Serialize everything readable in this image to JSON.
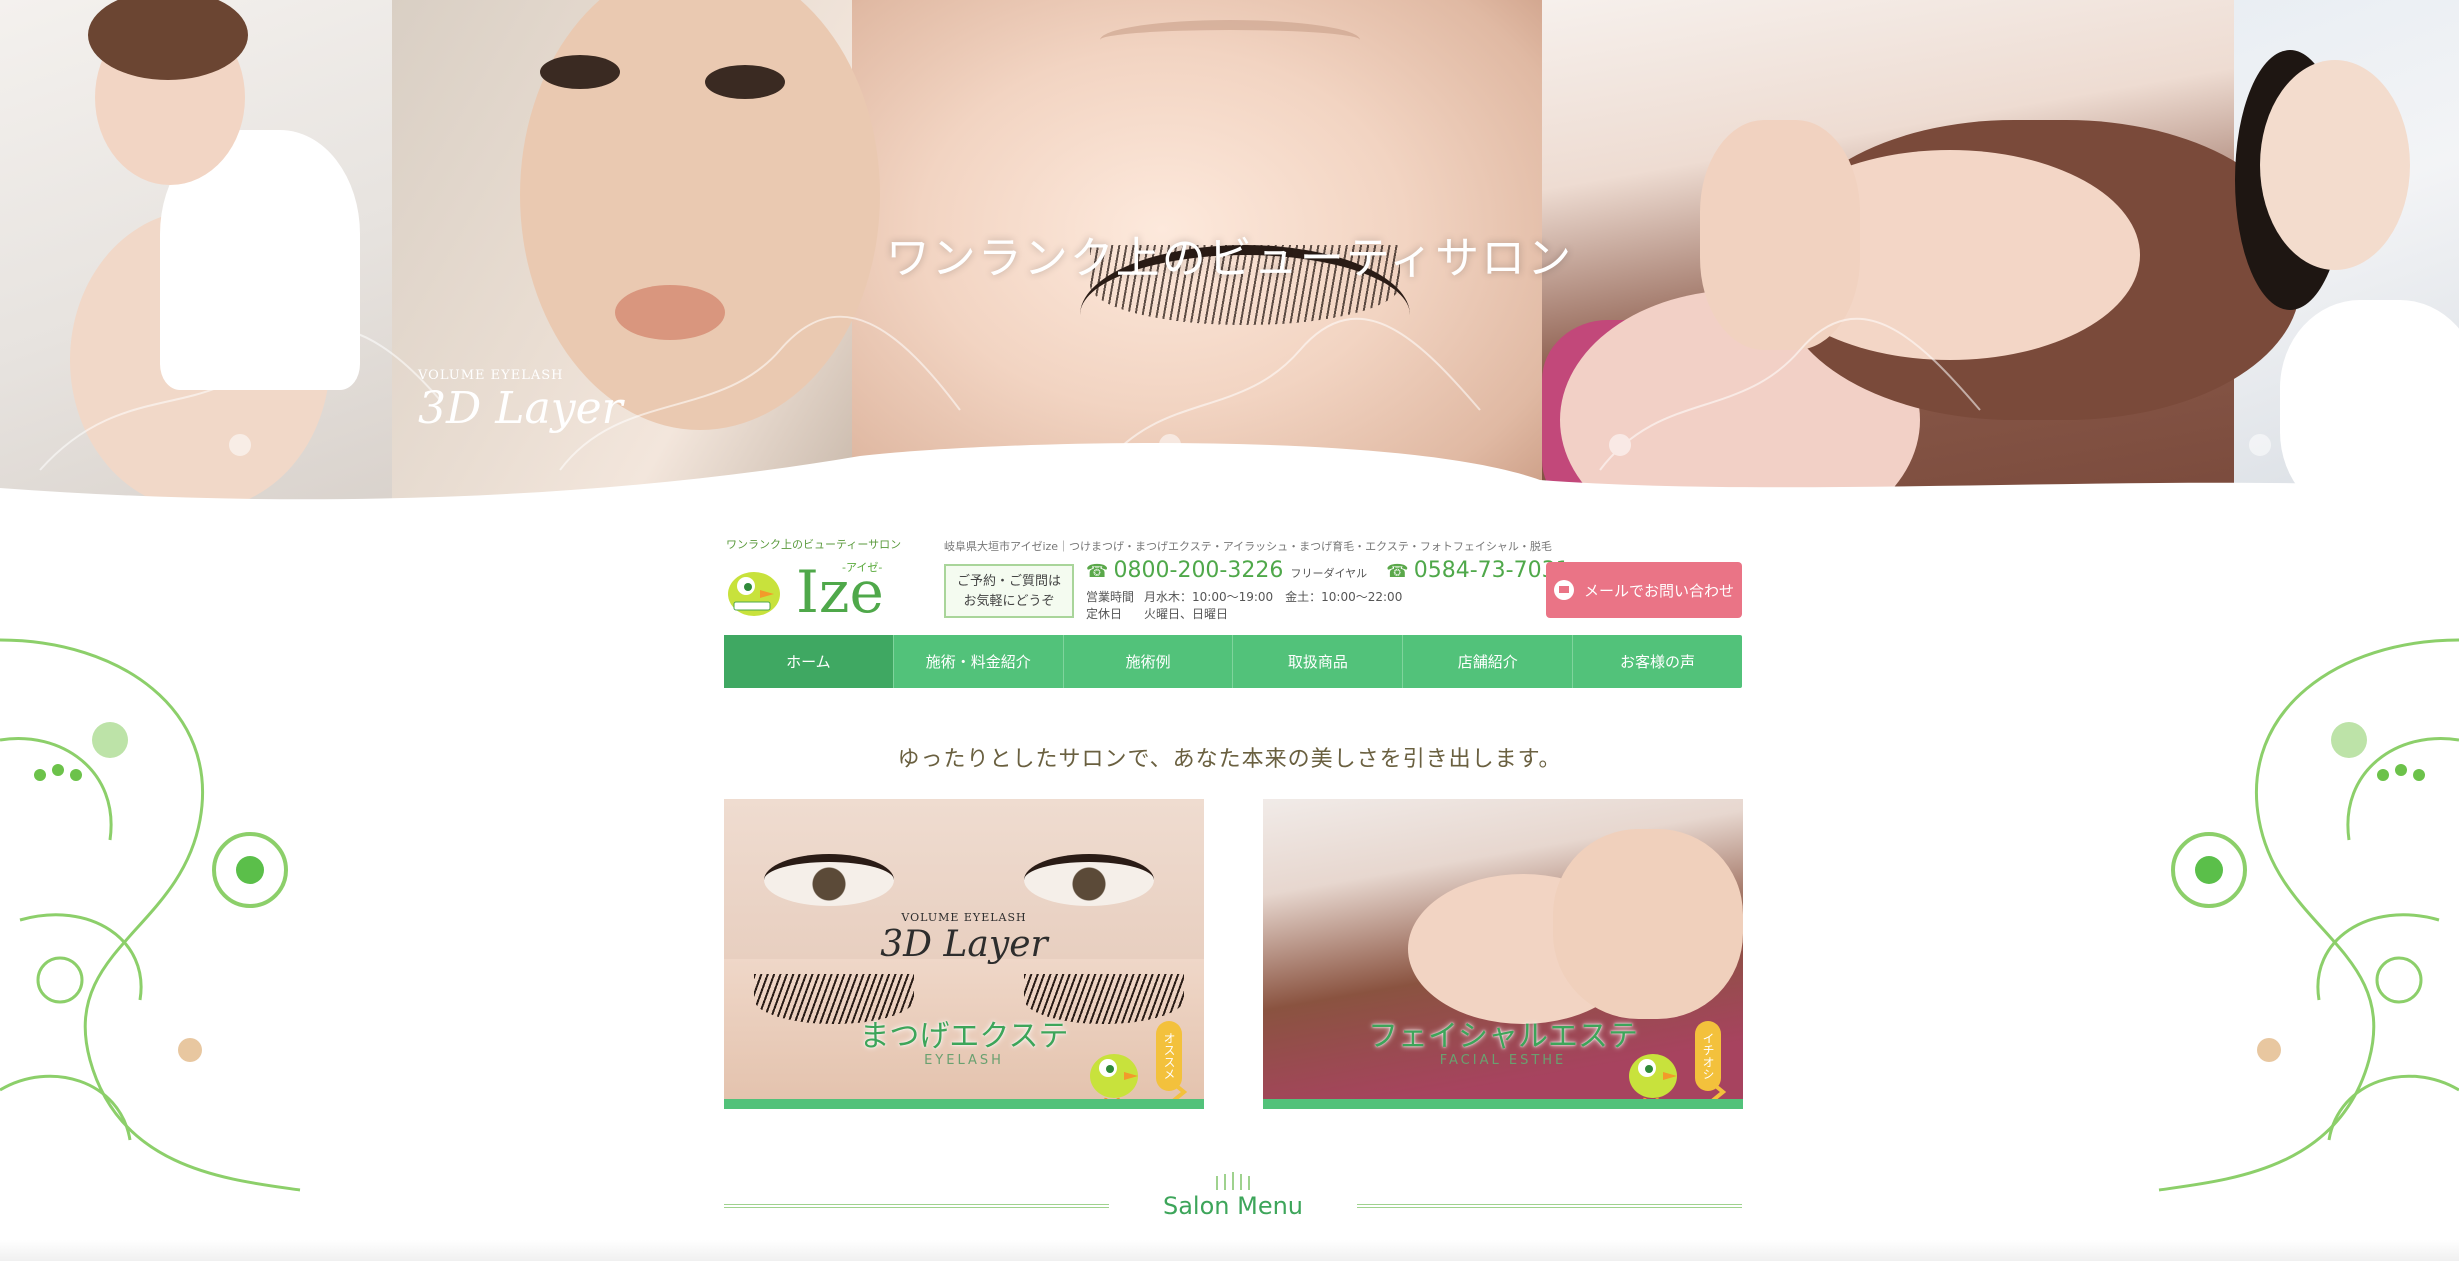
{
  "hero": {
    "title": "ワンランク上のビューティサロン",
    "panel2_brand_small": "VOLUME EYELASH",
    "panel2_brand_big": "3D Layer"
  },
  "header": {
    "logo_tagline": "ワンランク上のビューティーサロン",
    "logo_kana": "-アイゼ-",
    "logo_word": "Ize",
    "description": "岐阜県大垣市アイゼize｜つけまつげ・まつげエクステ・アイラッシュ・まつげ育毛・エクステ・フォトフェイシャル・脱毛",
    "inquiry_line1": "ご予約・ご質問は",
    "inquiry_line2": "お気軽にどうぞ",
    "phone1": "0800-200-3226",
    "phone1_note": "フリーダイヤル",
    "phone2": "0584-73-7031",
    "hours_label": "営業時間",
    "hours_value": "月水木：10:00〜19:00　金土：10:00〜22:00",
    "closed_label": "定休日",
    "closed_value": "火曜日、日曜日",
    "mail_button": "メールでお問い合わせ"
  },
  "nav": {
    "items": [
      {
        "label": "ホーム"
      },
      {
        "label": "施術・料金紹介"
      },
      {
        "label": "施術例"
      },
      {
        "label": "取扱商品"
      },
      {
        "label": "店舗紹介"
      },
      {
        "label": "お客様の声"
      }
    ]
  },
  "tagline": "ゆったりとしたサロンで、あなた本来の美しさを引き出します。",
  "cards": [
    {
      "brand_small": "VOLUME EYELASH",
      "brand_big": "3D Layer",
      "title": "まつげエクステ",
      "subtitle": "EYELASH",
      "badge": "オススメ"
    },
    {
      "title": "フェイシャルエステ",
      "subtitle": "FACIAL ESTHE",
      "badge": "イチオシ"
    }
  ],
  "salon_menu": {
    "title": "Salon Menu"
  },
  "colors": {
    "primary_green": "#52c27a",
    "active_green": "#3fa862",
    "mail_pink": "#ea7486",
    "logo_green": "#4fa84a"
  },
  "icons": {
    "phone": "phone-icon",
    "mail": "mail-icon",
    "chevron": "chevron-right-icon"
  }
}
